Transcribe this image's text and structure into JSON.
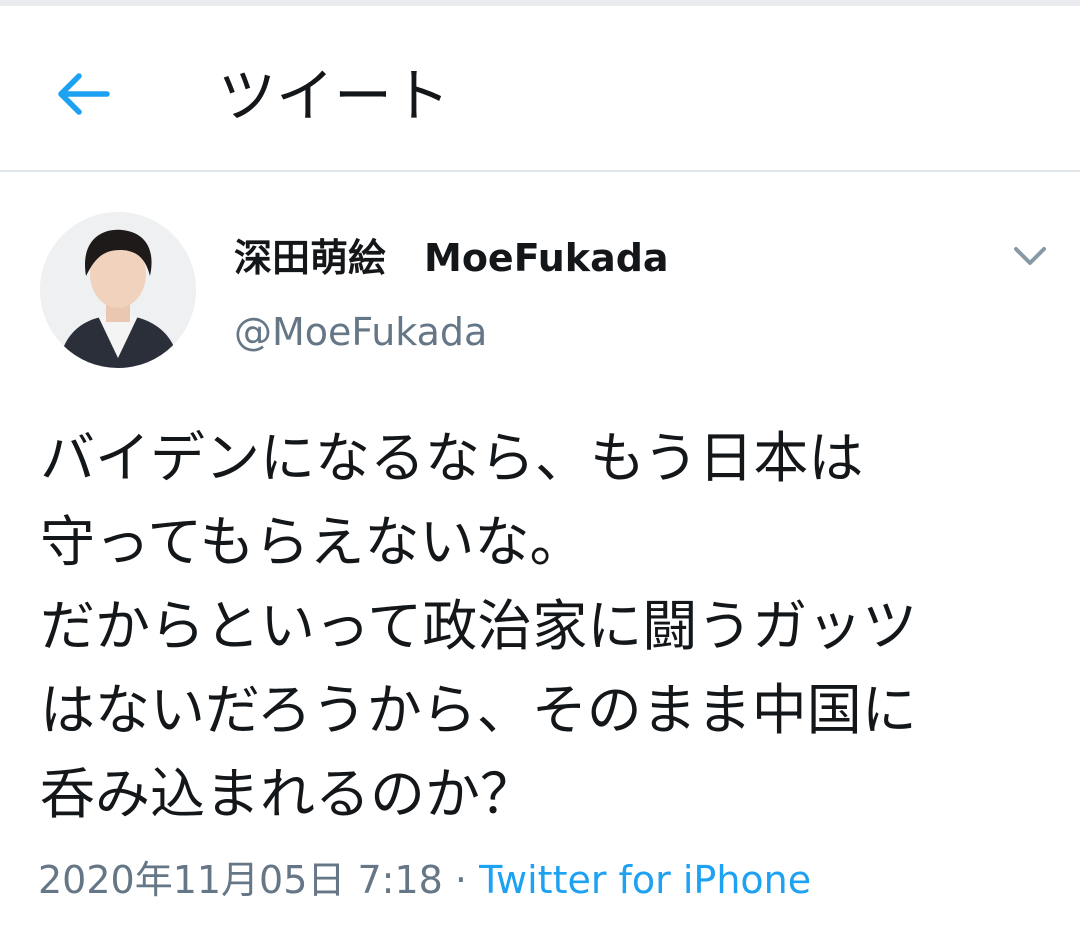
{
  "header": {
    "back_icon": "arrow-left-icon",
    "title": "ツイート",
    "accent_color": "#1da1f2"
  },
  "tweet": {
    "author": {
      "display_name": "深田萌絵　MoeFukada",
      "handle": "@MoeFukada"
    },
    "menu_icon": "chevron-down-icon",
    "text": "バイデンになるなら、もう日本は\n守ってもらえないな。\nだからといって政治家に闘うガッツ\nはないだろうから、そのまま中国に\n呑み込まれるのか？",
    "timestamp": "2020年11月05日 7:18",
    "separator": "·",
    "source": "Twitter for iPhone"
  },
  "colors": {
    "text_primary": "#14171a",
    "text_secondary": "#657786",
    "link": "#1da1f2",
    "divider": "#e1e8ed"
  }
}
